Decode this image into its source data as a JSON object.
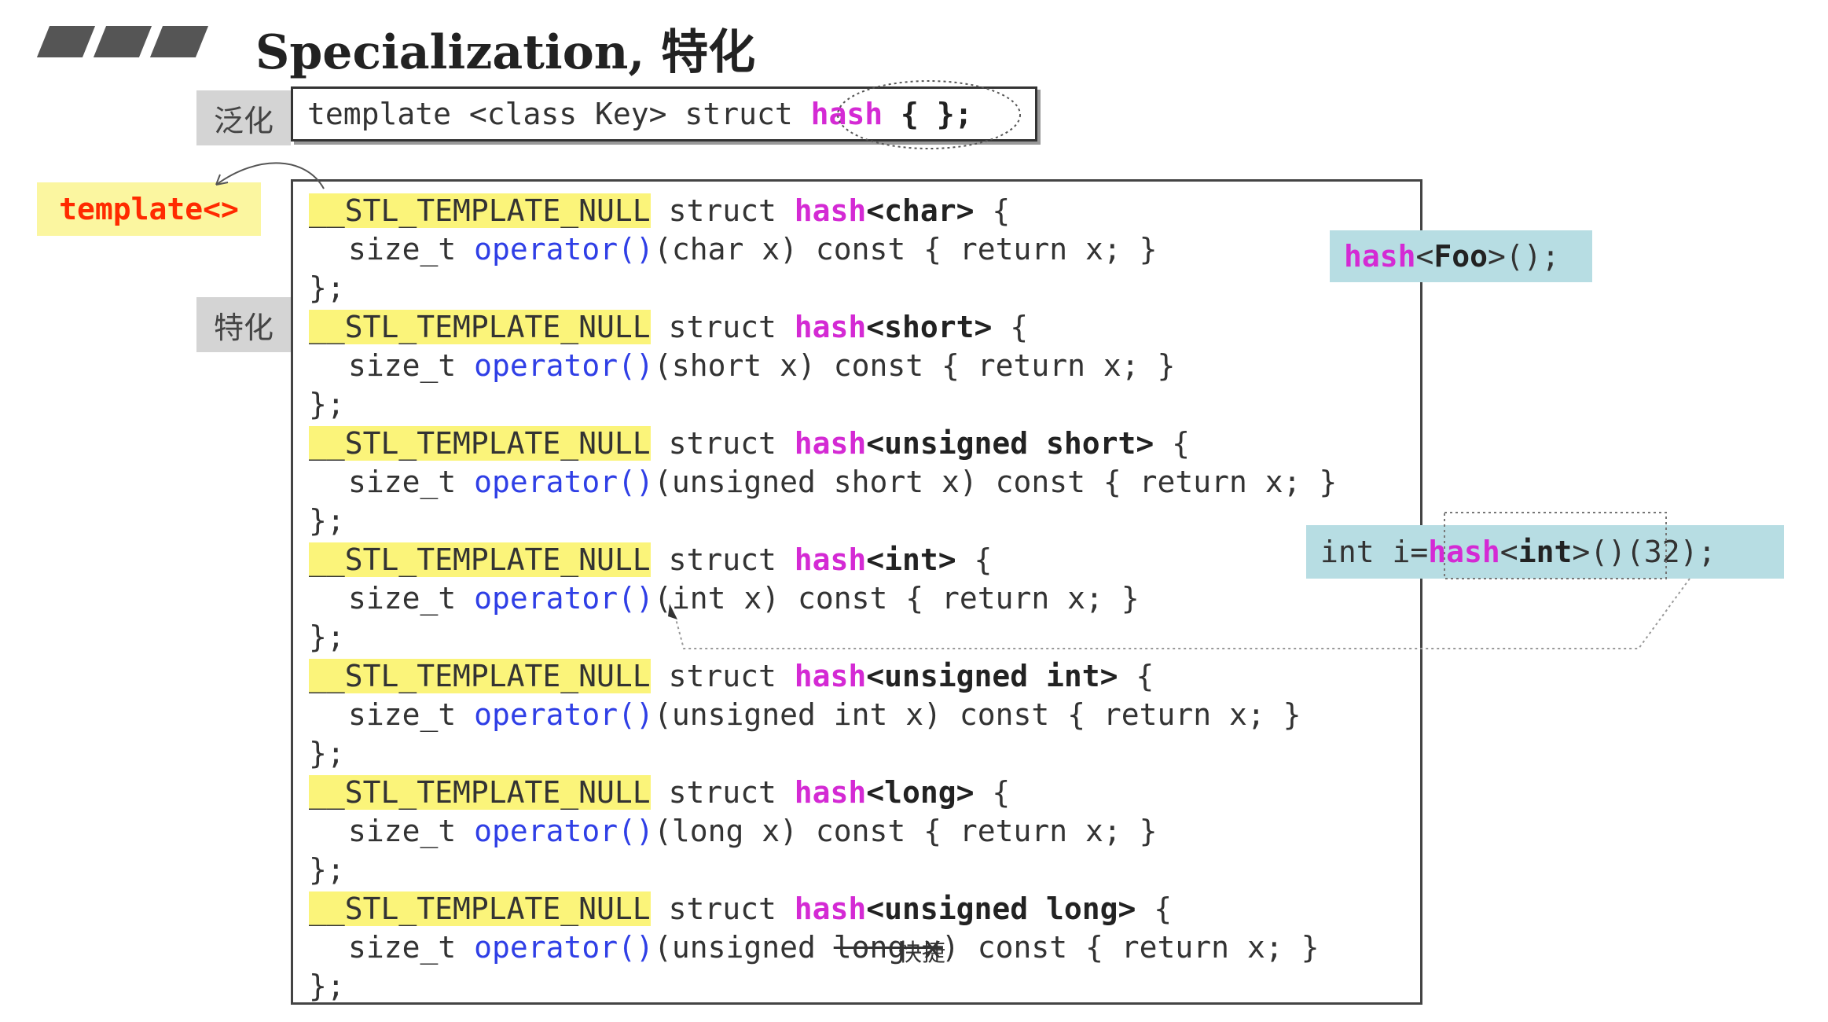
{
  "title": "Specialization, 特化",
  "labels": {
    "generic": "泛化",
    "specialize": "特化",
    "template": "template<>"
  },
  "generic_decl": {
    "prefix": "template <class Key> struct ",
    "hash": "hash",
    "suffix": " { };"
  },
  "code": {
    "macro": "__STL_TEMPLATE_NULL",
    "struct_kw": " struct ",
    "hash": "hash",
    "open_brace": " {",
    "size_t": "size_t ",
    "operator": "operator()",
    "close": "};",
    "blocks": [
      {
        "type": "<char>",
        "param": "(char x)",
        "body": " const { return x; }"
      },
      {
        "type": "<short>",
        "param": "(short x)",
        "body": " const { return x; }"
      },
      {
        "type": "<unsigned short>",
        "param": "(unsigned short x)",
        "body": " const { return x; }"
      },
      {
        "type": "<int>",
        "param": "(int x)",
        "body": " const { return x; }"
      },
      {
        "type": "<unsigned int>",
        "param": "(unsigned int x)",
        "body": " const { return x; }"
      },
      {
        "type": "<long>",
        "param": "(long x)",
        "body": " const { return x; }"
      },
      {
        "type": "<unsigned long>",
        "param_prefix": "(unsigned ",
        "param_struck": "long x",
        "param_suffix": ")",
        "body": " const { return x; }"
      }
    ],
    "overlay": "快捷"
  },
  "side_foo": {
    "hash": "hash",
    "lt": "<",
    "type": "Foo",
    "rest": ">();"
  },
  "side_int": {
    "prefix": "int i=",
    "hash": "hash",
    "lt": "<",
    "type": "int",
    "mid": ">()",
    "arg": "(32);"
  },
  "colors": {
    "hash": "#d42ad4",
    "operator": "#2f3fe6",
    "macro_bg": "#fbf47a",
    "template_label": "#ff2a00",
    "side_bg": "#b7dde3"
  }
}
